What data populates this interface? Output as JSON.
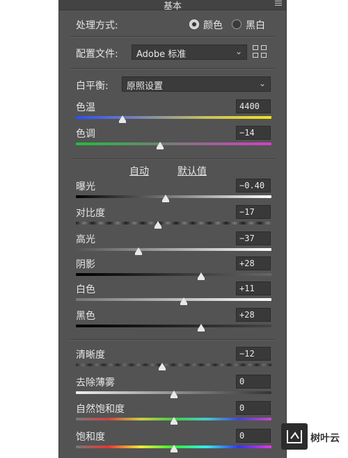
{
  "panel": {
    "title": "基本"
  },
  "treatment": {
    "label": "处理方式:",
    "options": [
      {
        "label": "颜色",
        "selected": true
      },
      {
        "label": "黑白",
        "selected": false
      }
    ]
  },
  "profile": {
    "label": "配置文件:",
    "value": "Adobe 标准"
  },
  "white_balance": {
    "label": "白平衡:",
    "value": "原照设置"
  },
  "auto_default": {
    "auto": "自动",
    "default": "默认值"
  },
  "sliders": [
    {
      "label": "色温",
      "value": "4400",
      "fraction": 0.24,
      "track": "temp"
    },
    {
      "label": "色调",
      "value": "−14",
      "fraction": 0.43,
      "track": "tint"
    },
    {
      "label": "曝光",
      "value": "−0.40",
      "fraction": 0.46,
      "track": "exposure"
    },
    {
      "label": "对比度",
      "value": "−17",
      "fraction": 0.42,
      "track": "contrast"
    },
    {
      "label": "高光",
      "value": "−37",
      "fraction": 0.32,
      "track": "highlights"
    },
    {
      "label": "阴影",
      "value": "+28",
      "fraction": 0.64,
      "track": "shadows"
    },
    {
      "label": "白色",
      "value": "+11",
      "fraction": 0.55,
      "track": "whites"
    },
    {
      "label": "黑色",
      "value": "+28",
      "fraction": 0.64,
      "track": "blacks"
    },
    {
      "label": "清晰度",
      "value": "−12",
      "fraction": 0.44,
      "track": "clarity"
    },
    {
      "label": "去除薄雾",
      "value": "0",
      "fraction": 0.5,
      "track": "dehaze"
    },
    {
      "label": "自然饱和度",
      "value": "0",
      "fraction": 0.5,
      "track": "vibrance"
    },
    {
      "label": "饱和度",
      "value": "0",
      "fraction": 0.5,
      "track": "saturation"
    }
  ],
  "watermark": {
    "text": "树叶云"
  }
}
